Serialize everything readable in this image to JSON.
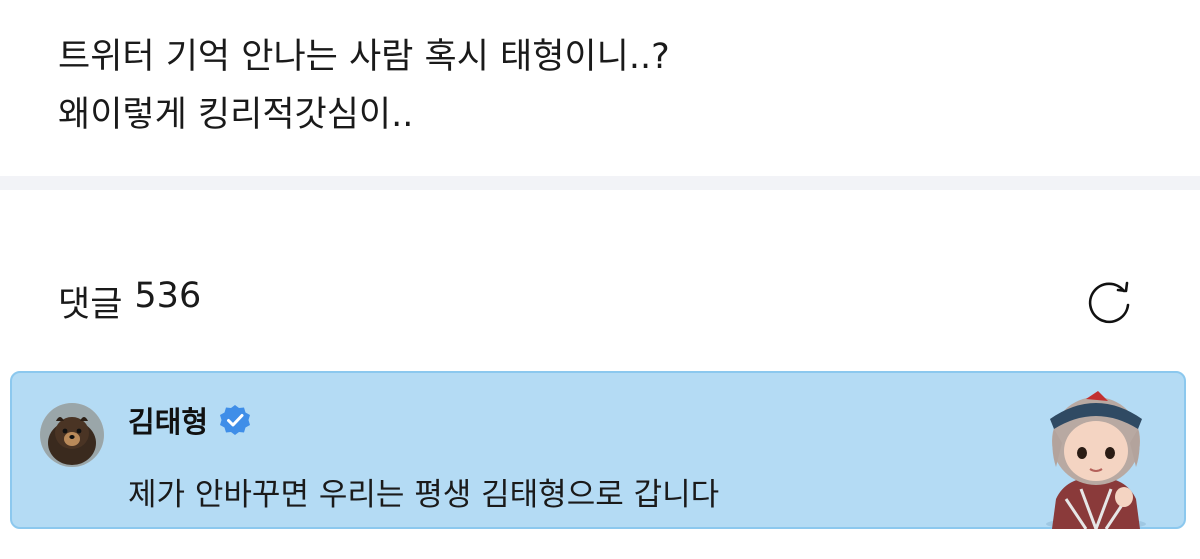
{
  "post": {
    "lines": [
      "트위터 기억 안나는 사람 혹시 태형이니..?",
      "왜이렇게 킹리적갓심이.."
    ]
  },
  "comments": {
    "label": "댓글",
    "count": "536",
    "refresh_icon": "refresh-icon"
  },
  "pinned_comment": {
    "author": "김태형",
    "verified_icon": "verified-badge-icon",
    "text": "제가 안바꾸면 우리는 평생 김태형으로 갑니다",
    "card_color": "#b4dbf4"
  }
}
